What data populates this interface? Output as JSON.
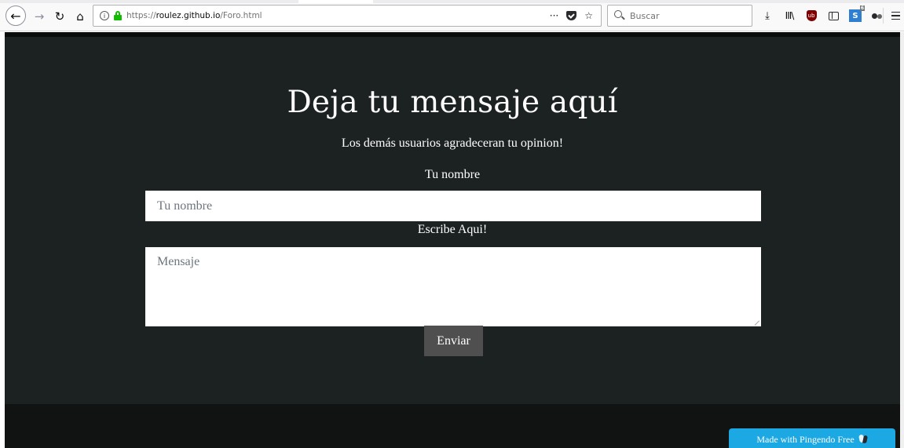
{
  "browser": {
    "url_scheme": "https://",
    "url_host": "roulez.github.io",
    "url_path": "/Foro.html",
    "url_more": "···",
    "search_placeholder": "Buscar",
    "icons": {
      "back": "back-arrow-icon",
      "forward": "forward-arrow-icon",
      "reload": "reload-icon",
      "home": "home-icon",
      "info": "info-icon",
      "lock": "lock-icon",
      "page_actions": "more-icon",
      "pocket": "pocket-icon",
      "bookmark": "star-icon",
      "search": "search-icon",
      "downloads": "download-icon",
      "library": "library-icon",
      "ublock": "ublock-icon",
      "sidebar": "sidebar-icon",
      "extension_s": "extension-s-icon",
      "extension_badge": "6",
      "extension_paw": "extension-icon",
      "menu": "hamburger-menu-icon"
    }
  },
  "page": {
    "title": "Deja tu mensaje aquí",
    "subtitle": "Los demás usuarios agradeceran tu opinion!",
    "name_label": "Tu nombre",
    "name_placeholder": "Tu nombre",
    "message_label": "Escribe Aqui!",
    "message_placeholder": "Mensaje",
    "submit_label": "Enviar",
    "badge_text": "Made with Pingendo Free",
    "colors": {
      "background": "#1c2222",
      "footer": "#111212",
      "button": "#4f4f4f",
      "badge": "#1ca8e3",
      "text": "#ffffff"
    }
  }
}
